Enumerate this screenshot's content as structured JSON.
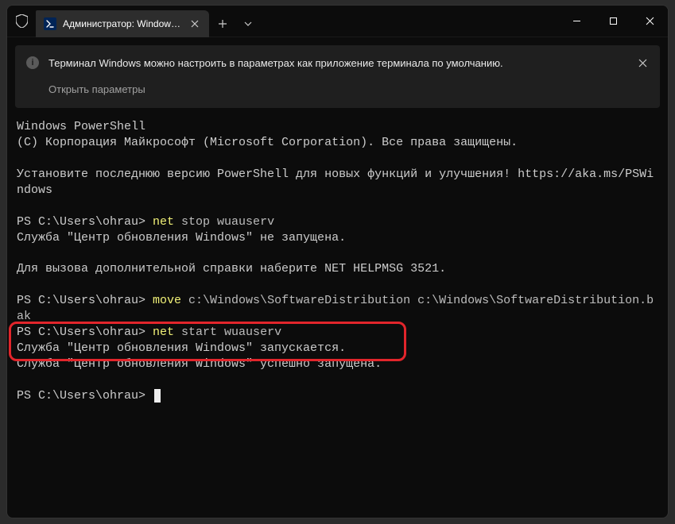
{
  "titlebar": {
    "tab_title": "Администратор: Windows Pc",
    "shield_name": "shield-icon"
  },
  "banner": {
    "text": "Терминал Windows можно настроить в параметрах как приложение терминала по умолчанию.",
    "link": "Открыть параметры"
  },
  "terminal": {
    "line1": "Windows PowerShell",
    "line2": "(C) Корпорация Майкрософт (Microsoft Corporation). Все права защищены.",
    "line3": "Установите последнюю версию PowerShell для новых функций и улучшения! https://aka.ms/PSWindows",
    "prompt1": "PS C:\\Users\\ohrau> ",
    "cmd1a": "net ",
    "cmd1b": "stop wuauserv",
    "out1": "Служба \"Центр обновления Windows\" не запущена.",
    "out2": "Для вызова дополнительной справки наберите NET HELPMSG 3521.",
    "prompt2": "PS C:\\Users\\ohrau> ",
    "cmd2a": "move ",
    "cmd2b": "c:\\Windows\\SoftwareDistribution c:\\Windows\\SoftwareDistribution.bak",
    "prompt3": "PS C:\\Users\\ohrau> ",
    "cmd3a": "net ",
    "cmd3b": "start wuauserv",
    "out3": "Служба \"Центр обновления Windows\" запускается.",
    "out4": "Служба \"Центр обновления Windows\" успешно запущена.",
    "prompt4": "PS C:\\Users\\ohrau> "
  }
}
